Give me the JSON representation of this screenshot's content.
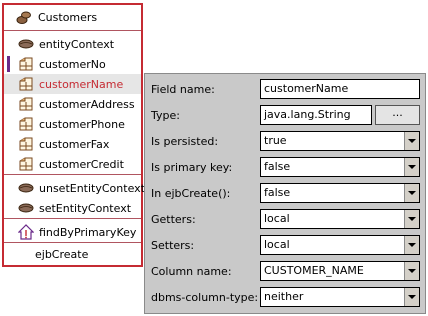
{
  "class_box": {
    "title": "Customers",
    "items": [
      {
        "label": "entityContext"
      },
      {
        "label": "customerNo"
      },
      {
        "label": "customerName"
      },
      {
        "label": "customerAddress"
      },
      {
        "label": "customerPhone"
      },
      {
        "label": "customerFax"
      },
      {
        "label": "customerCredit"
      },
      {
        "label": "unsetEntityContext"
      },
      {
        "label": "setEntityContext"
      },
      {
        "label": "findByPrimaryKey"
      },
      {
        "label": "ejbCreate"
      }
    ],
    "selected": "customerName"
  },
  "properties": {
    "field_name": {
      "label": "Field name:",
      "value": "customerName"
    },
    "type": {
      "label": "Type:",
      "value": "java.lang.String",
      "button": "..."
    },
    "persisted": {
      "label": "Is persisted:",
      "value": "true"
    },
    "primary_key": {
      "label": "Is primary key:",
      "value": "false"
    },
    "in_ejbcreate": {
      "label": "In ejbCreate():",
      "value": "false"
    },
    "getters": {
      "label": "Getters:",
      "value": "local"
    },
    "setters": {
      "label": "Setters:",
      "value": "local"
    },
    "column_name": {
      "label": "Column name:",
      "value": "CUSTOMER_NAME"
    },
    "dbms_type": {
      "label": "dbms-column-type:",
      "value": "neither"
    }
  },
  "colors": {
    "accent": "#c52b33",
    "panel_bg": "#c9c9c9",
    "selected_bg": "#e6e6e6"
  }
}
